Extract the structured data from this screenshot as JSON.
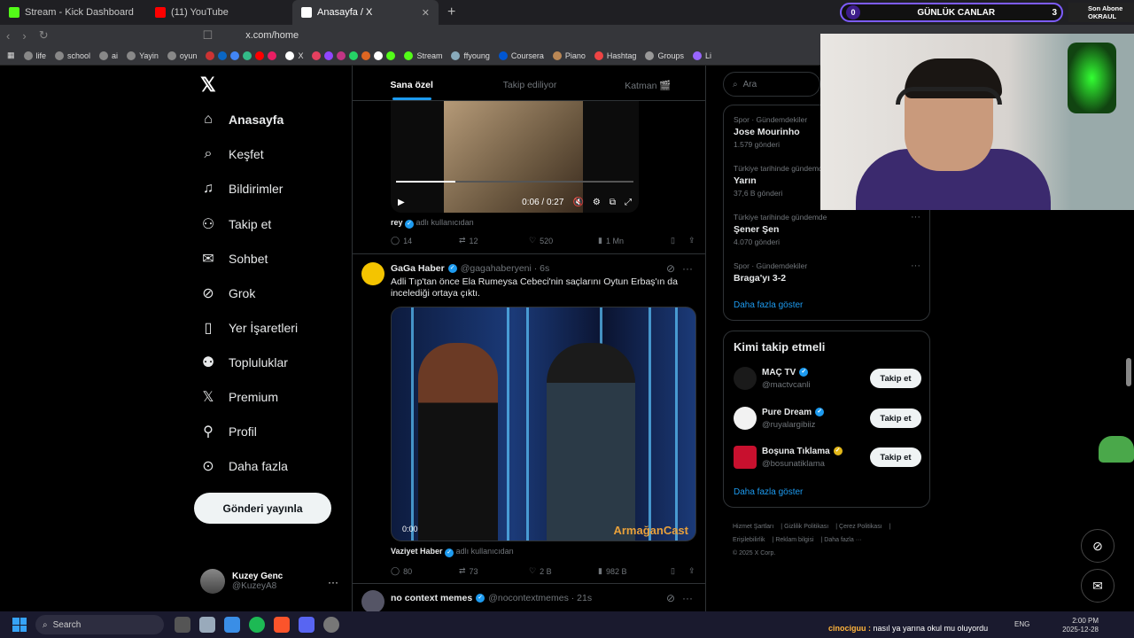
{
  "browser": {
    "tabs": [
      {
        "title": "Stream - Kick Dashboard",
        "color": "#53fc18"
      },
      {
        "title": "(11) YouTube",
        "color": "#ff0000"
      },
      {
        "title": "Anasayfa / X",
        "color": "#ffffff"
      }
    ],
    "url": "x.com/home",
    "bookmarks": [
      "life",
      "school",
      "ai",
      "Yayin",
      "oyun",
      "X",
      "Stream",
      "ffyoung",
      "Coursera",
      "Piano",
      "Hashtag",
      "Groups",
      "Li"
    ]
  },
  "nav": {
    "items": [
      {
        "label": "Anasayfa",
        "icon": "home-icon",
        "glyph": "⌂"
      },
      {
        "label": "Keşfet",
        "icon": "search-icon",
        "glyph": "⌕"
      },
      {
        "label": "Bildirimler",
        "icon": "bell-icon",
        "glyph": "🔔"
      },
      {
        "label": "Takip et",
        "icon": "add-user-icon",
        "glyph": "👤"
      },
      {
        "label": "Sohbet",
        "icon": "mail-icon",
        "glyph": "✉"
      },
      {
        "label": "Grok",
        "icon": "grok-icon",
        "glyph": "⊘"
      },
      {
        "label": "Yer İşaretleri",
        "icon": "bookmark-icon",
        "glyph": "🔖"
      },
      {
        "label": "Topluluklar",
        "icon": "communities-icon",
        "glyph": "👥"
      },
      {
        "label": "Premium",
        "icon": "x-icon",
        "glyph": "𝕏"
      },
      {
        "label": "Profil",
        "icon": "profile-icon",
        "glyph": "👤"
      },
      {
        "label": "Daha fazla",
        "icon": "more-circle-icon",
        "glyph": "⋯"
      }
    ],
    "post_button": "Gönderi yayınla",
    "user": {
      "name": "Kuzey Genc",
      "handle": "@KuzeyA8"
    }
  },
  "feed": {
    "tabs": [
      "Sana özel",
      "Takip ediliyor",
      "Katman 🎬"
    ],
    "tweet1": {
      "video_time": "0:06 / 0:27",
      "attribution_user": "rey",
      "attribution_suffix": "adlı kullanıcıdan",
      "replies": "14",
      "retweets": "12",
      "likes": "520",
      "views": "1 Mn"
    },
    "tweet2": {
      "name": "GaGa Haber",
      "handle": "@gagahaberyeni · 6s",
      "text": "Adli Tıp'tan önce Ela Rumeysa Cebeci'nin saçlarını Oytun Erbaş'ın da incelediği ortaya çıktı.",
      "video_time": "0:00",
      "watermark": "ArmağanCast",
      "attribution_user": "Vaziyet Haber",
      "attribution_suffix": "adlı kullanıcıdan",
      "replies": "80",
      "retweets": "73",
      "likes": "2 B",
      "views": "982 B"
    },
    "tweet3": {
      "name": "no context memes",
      "handle": "@nocontextmemes · 21s"
    }
  },
  "sidebar": {
    "search_placeholder": "Ara",
    "trends": [
      {
        "context": "Spor · Gündemdekiler",
        "title": "Jose Mourinho",
        "count": "1.579 gönderi"
      },
      {
        "context": "Türkiye tarihinde gündemde",
        "title": "Yarın",
        "count": "37,6 B gönderi"
      },
      {
        "context": "Türkiye tarihinde gündemde",
        "title": "Şener Şen",
        "count": "4.070 gönderi"
      },
      {
        "context": "Spor · Gündemdekiler",
        "title": "Braga'yı 3-2",
        "count": ""
      }
    ],
    "show_more": "Daha fazla göster",
    "who_title": "Kimi takip etmeli",
    "who": [
      {
        "name": "MAÇ TV",
        "handle": "@mactvcanli",
        "color": "#1a1a1a",
        "badge": "blue"
      },
      {
        "name": "Pure Dream",
        "handle": "@ruyalargibiiz",
        "color": "#f2f2f2",
        "badge": "blue"
      },
      {
        "name": "Boşuna Tıklama",
        "handle": "@bosunatiklama",
        "color": "#c8102e",
        "badge": "gold"
      }
    ],
    "follow_label": "Takip et",
    "footer": [
      "Hizmet Şartları",
      "Gizlilik Politikası",
      "Çerez Politikası",
      "Erişilebilirlik",
      "Reklam bilgisi",
      "Daha fazla ···",
      "© 2025 X Corp."
    ]
  },
  "overlay": {
    "counter_left": "0",
    "counter_label": "GÜNLÜK CANLAR",
    "counter_right": "3",
    "sub_title": "Son Abone",
    "sub_name": "OKRAUL",
    "chat_user": "cinociguu :",
    "chat_text": "nasıl ya yarına okul mu oluyordu"
  },
  "taskbar": {
    "search": "Search",
    "time": "2:00 PM",
    "date": "2025-12-28",
    "lang": "ENG"
  }
}
